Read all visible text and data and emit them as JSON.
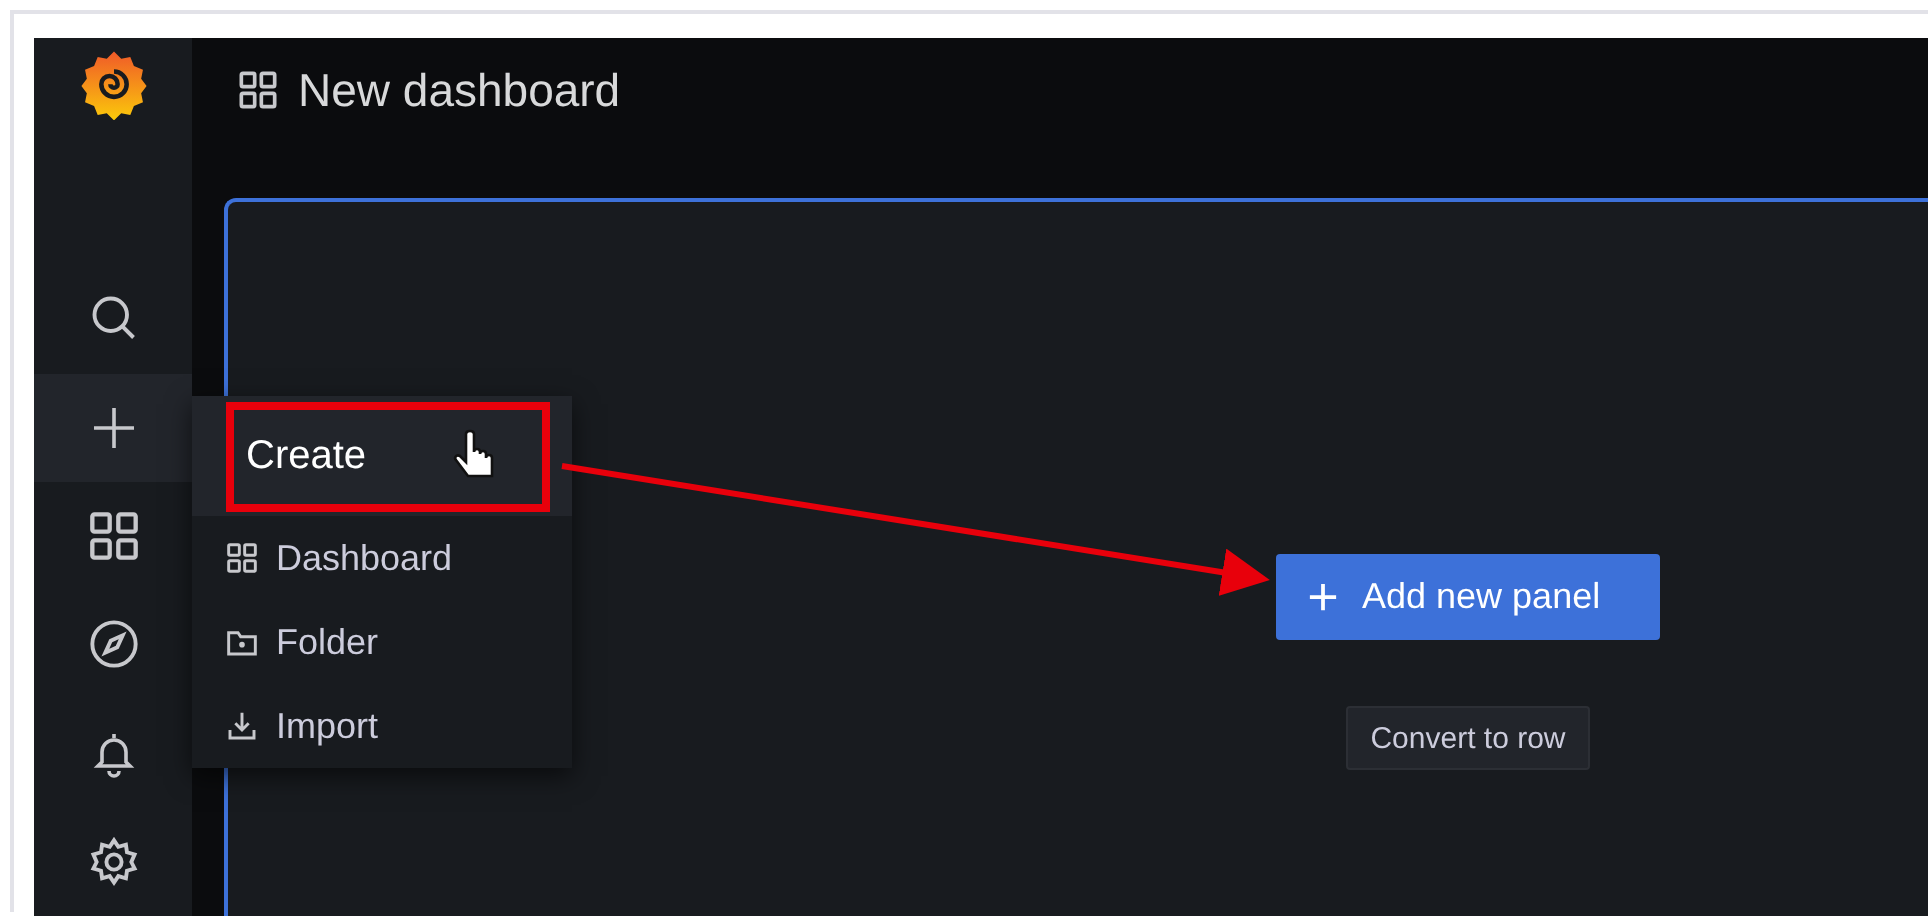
{
  "header": {
    "title": "New dashboard"
  },
  "sidebar": {
    "items": [
      {
        "kind": "search",
        "selected": false
      },
      {
        "kind": "create",
        "selected": true
      },
      {
        "kind": "dashboards",
        "selected": false
      },
      {
        "kind": "explore",
        "selected": false
      },
      {
        "kind": "alerting",
        "selected": false
      },
      {
        "kind": "configuration",
        "selected": false
      }
    ]
  },
  "create_menu": {
    "title": "Create",
    "items": [
      {
        "kind": "dashboard",
        "label": "Dashboard"
      },
      {
        "kind": "folder",
        "label": "Folder"
      },
      {
        "kind": "import",
        "label": "Import"
      }
    ]
  },
  "panel": {
    "primary_button": "Add new panel",
    "secondary_button": "Convert to row"
  }
}
